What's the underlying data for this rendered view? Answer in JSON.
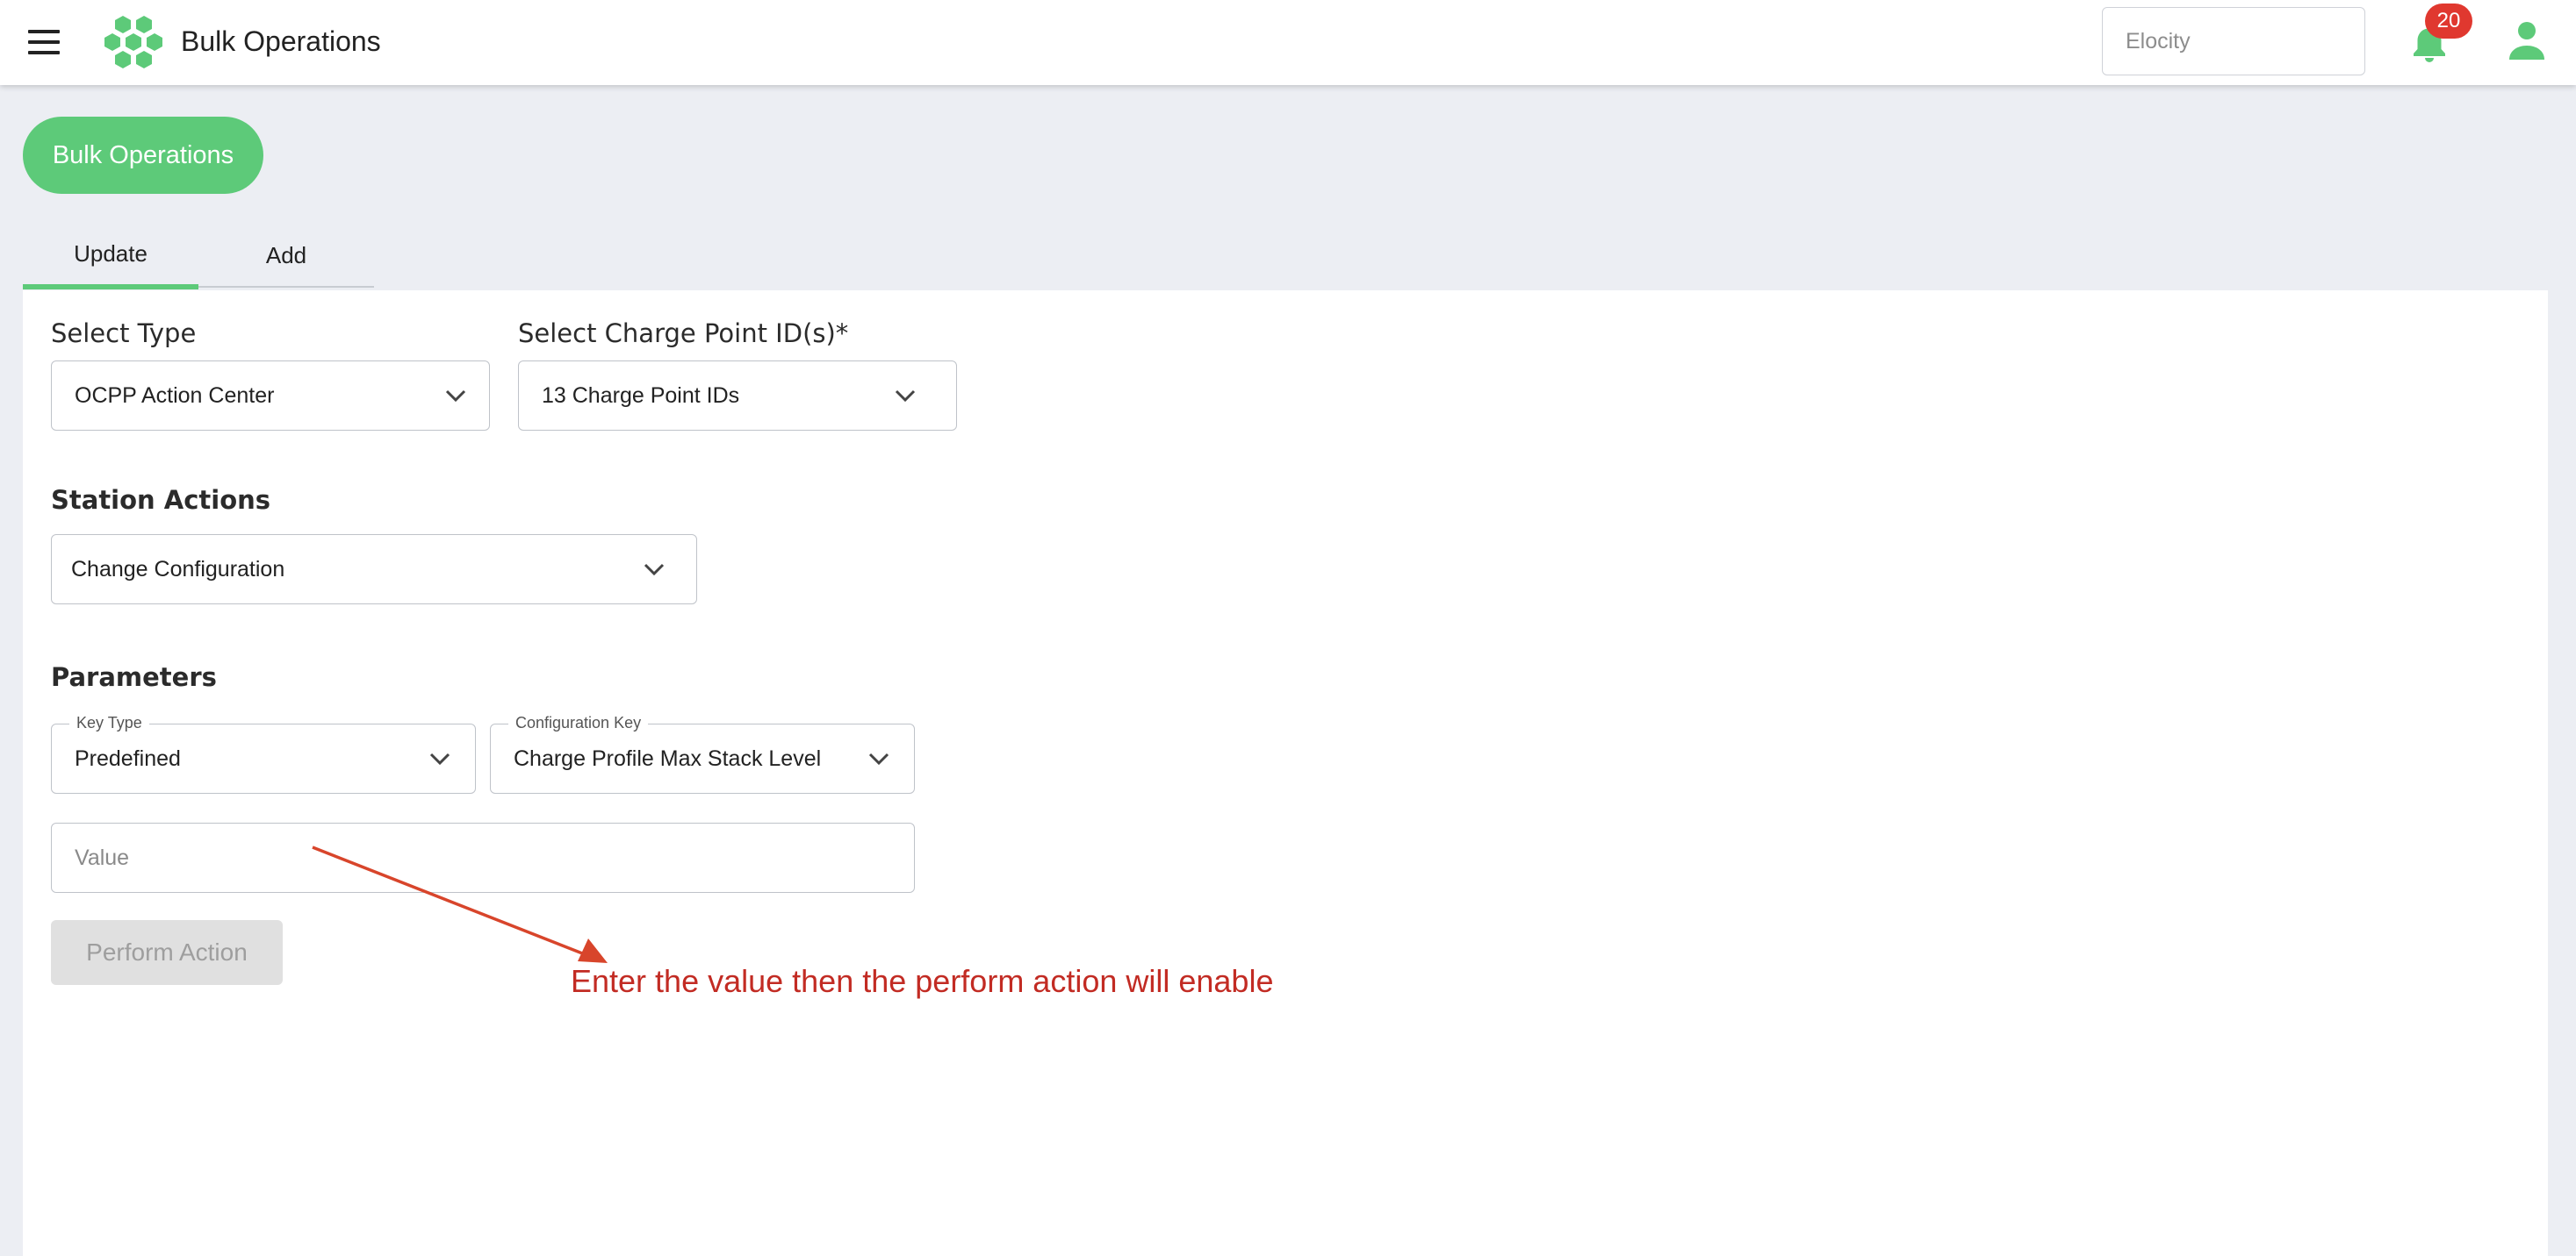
{
  "header": {
    "title": "Bulk Operations",
    "org_placeholder": "Elocity",
    "notification_count": "20"
  },
  "page": {
    "pill_label": "Bulk Operations"
  },
  "tabs": [
    {
      "label": "Update",
      "active": true
    },
    {
      "label": "Add",
      "active": false
    }
  ],
  "form": {
    "select_type": {
      "label": "Select Type",
      "value": "OCPP Action Center"
    },
    "charge_points": {
      "label": "Select Charge Point ID(s)*",
      "value": "13 Charge Point IDs"
    },
    "station_actions": {
      "label": "Station Actions",
      "value": "Change Configuration"
    },
    "parameters": {
      "label": "Parameters",
      "key_type": {
        "label": "Key Type",
        "value": "Predefined"
      },
      "configuration_key": {
        "label": "Configuration Key",
        "value": "Charge Profile Max Stack Level"
      },
      "value_placeholder": "Value"
    },
    "perform_button": "Perform Action"
  },
  "annotation": {
    "text": "Enter the value then the perform action will enable"
  },
  "colors": {
    "accent": "#5dca79",
    "badge": "#e0382f",
    "annotation": "#c22b23",
    "page_bg": "#eceef3"
  }
}
